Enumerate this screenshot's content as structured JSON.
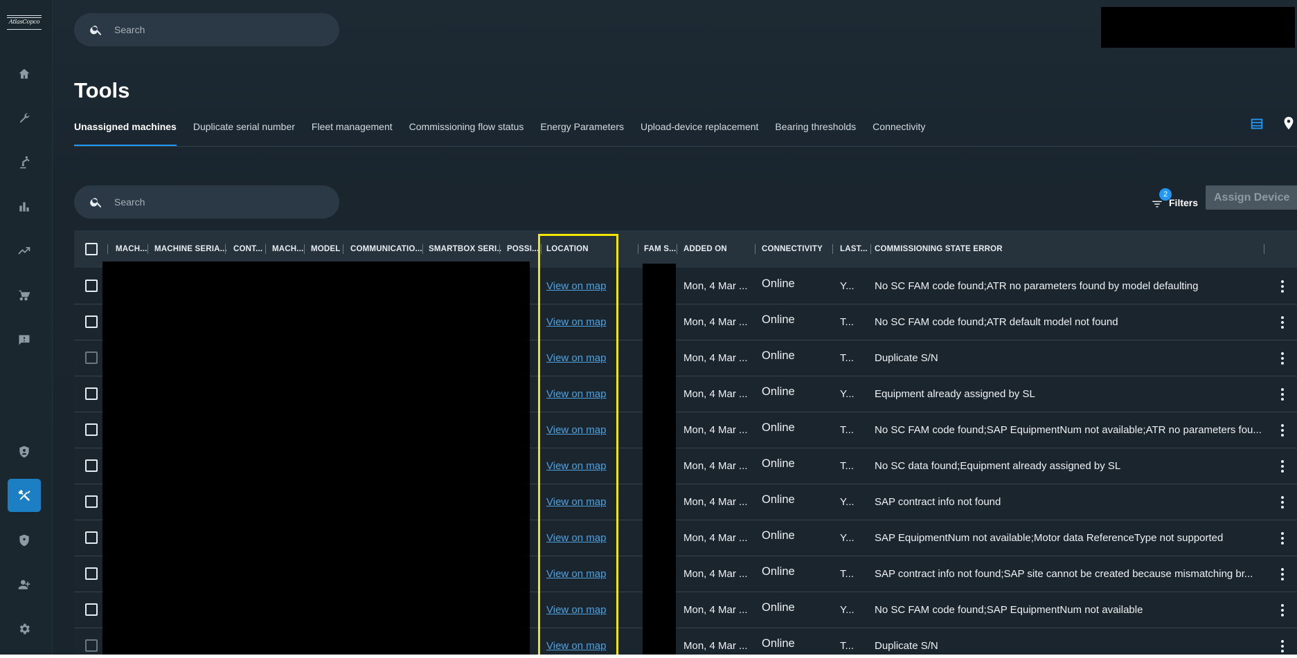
{
  "brand": {
    "logo_text": "AtlasCopco"
  },
  "sidebar": {
    "items": [
      {
        "name": "home-icon"
      },
      {
        "name": "wrench-icon"
      },
      {
        "name": "robot-arm-icon"
      },
      {
        "name": "bar-chart-icon"
      },
      {
        "name": "trend-icon"
      },
      {
        "name": "cart-icon"
      },
      {
        "name": "feedback-icon"
      },
      {
        "name": "shield-user-icon"
      },
      {
        "name": "tools-icon",
        "active": true
      },
      {
        "name": "shield-icon"
      },
      {
        "name": "add-user-icon"
      },
      {
        "name": "settings-icon"
      }
    ]
  },
  "header": {
    "search_placeholder": "Search"
  },
  "page": {
    "title": "Tools"
  },
  "tabs": [
    {
      "label": "Unassigned machines",
      "active": true
    },
    {
      "label": "Duplicate serial number"
    },
    {
      "label": "Fleet management"
    },
    {
      "label": "Commissioning flow status"
    },
    {
      "label": "Energy Parameters"
    },
    {
      "label": "Upload-device replacement"
    },
    {
      "label": "Bearing thresholds"
    },
    {
      "label": "Connectivity"
    }
  ],
  "toolbar": {
    "search_placeholder": "Search",
    "filters_label": "Filters",
    "filters_count": "2",
    "assign_label": "Assign Device"
  },
  "table": {
    "headers": {
      "mach1": "MACH...",
      "machine_serial": "MACHINE SERIA...",
      "cont": "CONT...",
      "mach2": "MACH...",
      "model": "MODEL",
      "communication": "COMMUNICATIO...",
      "smartbox_serial": "SMARTBOX SERI...",
      "possi": "POSSI...",
      "location": "LOCATION",
      "fam": "FAM S...",
      "added_on": "ADDED ON",
      "connectivity": "CONNECTIVITY",
      "last": "LAST...",
      "error": "COMMISSIONING STATE ERROR"
    },
    "rows": [
      {
        "location": "View on map",
        "added": "Mon, 4 Mar ...",
        "connectivity": "Online",
        "last": "Y...",
        "error": "No SC FAM code found;ATR no parameters found by model defaulting"
      },
      {
        "location": "View on map",
        "added": "Mon, 4 Mar ...",
        "connectivity": "Online",
        "last": "T...",
        "error": "No SC FAM code found;ATR default model not found"
      },
      {
        "location": "View on map",
        "added": "Mon, 4 Mar ...",
        "connectivity": "Online",
        "last": "T...",
        "error": "Duplicate S/N",
        "checkbox_disabled": true
      },
      {
        "location": "View on map",
        "added": "Mon, 4 Mar ...",
        "connectivity": "Online",
        "last": "Y...",
        "error": "Equipment already assigned by SL"
      },
      {
        "location": "View on map",
        "added": "Mon, 4 Mar ...",
        "connectivity": "Online",
        "last": "T...",
        "error": "No SC FAM code found;SAP EquipmentNum not available;ATR no parameters fou..."
      },
      {
        "location": "View on map",
        "added": "Mon, 4 Mar ...",
        "connectivity": "Online",
        "last": "T...",
        "error": "No SC data found;Equipment already assigned by SL"
      },
      {
        "location": "View on map",
        "added": "Mon, 4 Mar ...",
        "connectivity": "Online",
        "last": "Y...",
        "error": "SAP contract info not found"
      },
      {
        "location": "View on map",
        "added": "Mon, 4 Mar ...",
        "connectivity": "Online",
        "last": "Y...",
        "error": "SAP EquipmentNum not available;Motor data ReferenceType not supported"
      },
      {
        "location": "View on map",
        "added": "Mon, 4 Mar ...",
        "connectivity": "Online",
        "last": "T...",
        "error": "SAP contract info not found;SAP site cannot be created because mismatching br..."
      },
      {
        "location": "View on map",
        "added": "Mon, 4 Mar ...",
        "connectivity": "Online",
        "last": "Y...",
        "error": "No SC FAM code found;SAP EquipmentNum not available"
      },
      {
        "location": "View on map",
        "added": "Mon, 4 Mar ...",
        "connectivity": "Online",
        "last": "T...",
        "error": "Duplicate S/N",
        "checkbox_disabled": true
      }
    ]
  },
  "colors": {
    "accent": "#2196f3",
    "highlight": "#f3e600",
    "link": "#4fa3e0"
  }
}
